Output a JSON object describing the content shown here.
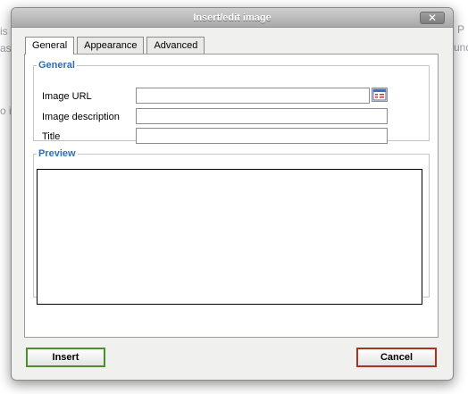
{
  "background": {
    "left_fragments": [
      "is",
      "as",
      "o i"
    ],
    "right_fragments": [
      "P",
      "und"
    ]
  },
  "dialog": {
    "title": "Insert/edit image",
    "close_label": "✕"
  },
  "tabs": [
    {
      "label": "General",
      "active": true
    },
    {
      "label": "Appearance",
      "active": false
    },
    {
      "label": "Advanced",
      "active": false
    }
  ],
  "general": {
    "legend": "General",
    "image_url": {
      "label": "Image URL",
      "value": ""
    },
    "image_description": {
      "label": "Image description",
      "value": ""
    },
    "title": {
      "label": "Title",
      "value": ""
    }
  },
  "preview": {
    "legend": "Preview"
  },
  "actions": {
    "insert_label": "Insert",
    "cancel_label": "Cancel"
  },
  "colors": {
    "legend": "#2b6fb6",
    "insert_border": "#4c8f2a",
    "cancel_border": "#a8341f"
  },
  "icons": {
    "browse": "browse-list-icon",
    "close": "close-icon"
  }
}
